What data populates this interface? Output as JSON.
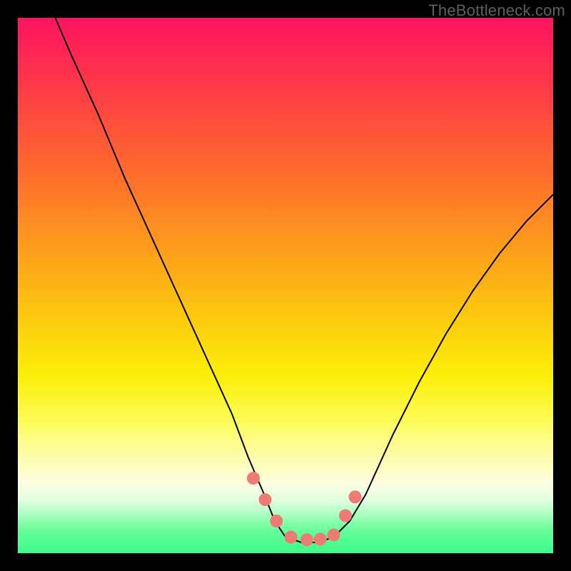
{
  "watermark": "TheBottleneck.com",
  "chart_data": {
    "type": "line",
    "title": "",
    "xlabel": "",
    "ylabel": "",
    "xlim": [
      0,
      100
    ],
    "ylim": [
      0,
      100
    ],
    "grid": false,
    "legend": false,
    "series": [
      {
        "name": "black-curve",
        "color": "#000000",
        "stroke_width": 2,
        "x": [
          7,
          10,
          15,
          20,
          25,
          30,
          35,
          40,
          43,
          46,
          48,
          50,
          53,
          56,
          59,
          62,
          65,
          70,
          75,
          80,
          85,
          90,
          95,
          100
        ],
        "y": [
          100,
          93,
          82,
          70,
          59,
          48,
          37,
          26,
          18,
          11,
          6,
          3,
          2,
          2,
          3,
          6,
          11,
          22,
          32,
          41,
          49,
          56,
          62,
          67
        ]
      },
      {
        "name": "salmon-dots",
        "color": "#ed7c74",
        "marker": "circle",
        "marker_r": 9,
        "x": [
          44.0,
          46.2,
          48.3,
          51.0,
          54.0,
          56.5,
          59.0,
          61.2,
          63.0
        ],
        "y": [
          14.0,
          10.0,
          6.0,
          3.0,
          2.5,
          2.6,
          3.4,
          7.0,
          10.5
        ]
      }
    ],
    "annotations": []
  }
}
